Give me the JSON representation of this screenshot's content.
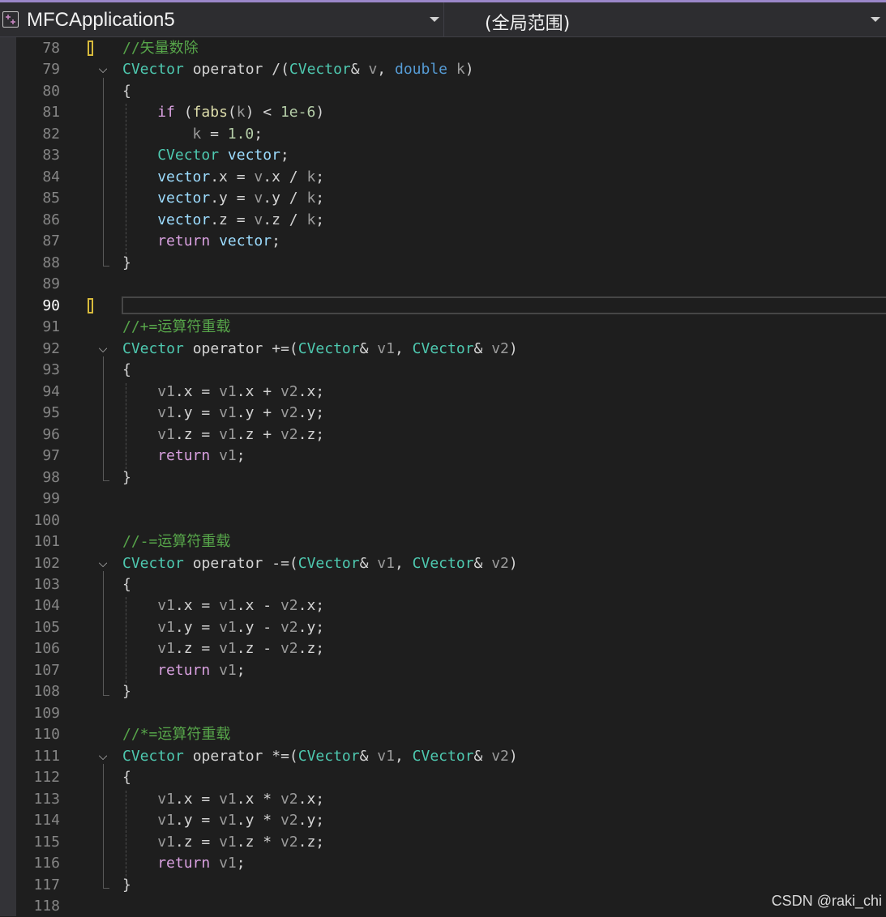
{
  "toolbar": {
    "project_name": "MFCApplication5",
    "project_icon": "cpp-project-icon",
    "scope": "(全局范围)"
  },
  "editor": {
    "active_line": "90",
    "lines": [
      {
        "n": "78",
        "mark": true,
        "tokens": [
          [
            "cmt",
            "//矢量数除"
          ]
        ]
      },
      {
        "n": "79",
        "fold": true,
        "tokens": [
          [
            "typ",
            "CVector"
          ],
          [
            "",
            " operator /("
          ],
          [
            "typ",
            "CVector"
          ],
          [
            "",
            "& "
          ],
          [
            "par",
            "v"
          ],
          [
            "",
            ", "
          ],
          [
            "kw",
            "double"
          ],
          [
            "",
            " "
          ],
          [
            "par",
            "k"
          ],
          [
            "",
            ")"
          ]
        ]
      },
      {
        "n": "80",
        "tokens": [
          [
            "",
            "{"
          ]
        ]
      },
      {
        "n": "81",
        "indent": 2,
        "tokens": [
          [
            "ctl",
            "if"
          ],
          [
            "",
            " ("
          ],
          [
            "fn",
            "fabs"
          ],
          [
            "",
            "("
          ],
          [
            "par",
            "k"
          ],
          [
            "",
            ") < "
          ],
          [
            "num",
            "1e-6"
          ],
          [
            "",
            ")"
          ]
        ]
      },
      {
        "n": "82",
        "indent": 4,
        "tokens": [
          [
            "par",
            "k"
          ],
          [
            "",
            " = "
          ],
          [
            "num",
            "1.0"
          ],
          [
            "",
            ";"
          ]
        ]
      },
      {
        "n": "83",
        "indent": 2,
        "tokens": [
          [
            "typ",
            "CVector"
          ],
          [
            "",
            " "
          ],
          [
            "var",
            "vector"
          ],
          [
            "",
            ";"
          ]
        ]
      },
      {
        "n": "84",
        "indent": 2,
        "tokens": [
          [
            "var",
            "vector"
          ],
          [
            "",
            ".x = "
          ],
          [
            "par",
            "v"
          ],
          [
            "",
            ".x / "
          ],
          [
            "par",
            "k"
          ],
          [
            "",
            ";"
          ]
        ]
      },
      {
        "n": "85",
        "indent": 2,
        "tokens": [
          [
            "var",
            "vector"
          ],
          [
            "",
            ".y = "
          ],
          [
            "par",
            "v"
          ],
          [
            "",
            ".y / "
          ],
          [
            "par",
            "k"
          ],
          [
            "",
            ";"
          ]
        ]
      },
      {
        "n": "86",
        "indent": 2,
        "tokens": [
          [
            "var",
            "vector"
          ],
          [
            "",
            ".z = "
          ],
          [
            "par",
            "v"
          ],
          [
            "",
            ".z / "
          ],
          [
            "par",
            "k"
          ],
          [
            "",
            ";"
          ]
        ]
      },
      {
        "n": "87",
        "indent": 2,
        "tokens": [
          [
            "ctl",
            "return"
          ],
          [
            "",
            " "
          ],
          [
            "var",
            "vector"
          ],
          [
            "",
            ";"
          ]
        ]
      },
      {
        "n": "88",
        "tokens": [
          [
            "",
            "}"
          ]
        ]
      },
      {
        "n": "89",
        "tokens": []
      },
      {
        "n": "90",
        "mark": true,
        "current": true,
        "tokens": []
      },
      {
        "n": "91",
        "tokens": [
          [
            "cmt",
            "//+=运算符重载"
          ]
        ]
      },
      {
        "n": "92",
        "fold": true,
        "tokens": [
          [
            "typ",
            "CVector"
          ],
          [
            "",
            " operator +=("
          ],
          [
            "typ",
            "CVector"
          ],
          [
            "",
            "& "
          ],
          [
            "par",
            "v1"
          ],
          [
            "",
            ", "
          ],
          [
            "typ",
            "CVector"
          ],
          [
            "",
            "& "
          ],
          [
            "par",
            "v2"
          ],
          [
            "",
            ")"
          ]
        ]
      },
      {
        "n": "93",
        "tokens": [
          [
            "",
            "{"
          ]
        ]
      },
      {
        "n": "94",
        "indent": 2,
        "tokens": [
          [
            "par",
            "v1"
          ],
          [
            "",
            ".x = "
          ],
          [
            "par",
            "v1"
          ],
          [
            "",
            ".x + "
          ],
          [
            "par",
            "v2"
          ],
          [
            "",
            ".x;"
          ]
        ]
      },
      {
        "n": "95",
        "indent": 2,
        "tokens": [
          [
            "par",
            "v1"
          ],
          [
            "",
            ".y = "
          ],
          [
            "par",
            "v1"
          ],
          [
            "",
            ".y + "
          ],
          [
            "par",
            "v2"
          ],
          [
            "",
            ".y;"
          ]
        ]
      },
      {
        "n": "96",
        "indent": 2,
        "tokens": [
          [
            "par",
            "v1"
          ],
          [
            "",
            ".z = "
          ],
          [
            "par",
            "v1"
          ],
          [
            "",
            ".z + "
          ],
          [
            "par",
            "v2"
          ],
          [
            "",
            ".z;"
          ]
        ]
      },
      {
        "n": "97",
        "indent": 2,
        "tokens": [
          [
            "ctl",
            "return"
          ],
          [
            "",
            " "
          ],
          [
            "par",
            "v1"
          ],
          [
            "",
            ";"
          ]
        ]
      },
      {
        "n": "98",
        "tokens": [
          [
            "",
            "}"
          ]
        ]
      },
      {
        "n": "99",
        "tokens": []
      },
      {
        "n": "100",
        "tokens": []
      },
      {
        "n": "101",
        "tokens": [
          [
            "cmt",
            "//-=运算符重载"
          ]
        ]
      },
      {
        "n": "102",
        "fold": true,
        "tokens": [
          [
            "typ",
            "CVector"
          ],
          [
            "",
            " operator -=("
          ],
          [
            "typ",
            "CVector"
          ],
          [
            "",
            "& "
          ],
          [
            "par",
            "v1"
          ],
          [
            "",
            ", "
          ],
          [
            "typ",
            "CVector"
          ],
          [
            "",
            "& "
          ],
          [
            "par",
            "v2"
          ],
          [
            "",
            ")"
          ]
        ]
      },
      {
        "n": "103",
        "tokens": [
          [
            "",
            "{"
          ]
        ]
      },
      {
        "n": "104",
        "indent": 2,
        "tokens": [
          [
            "par",
            "v1"
          ],
          [
            "",
            ".x = "
          ],
          [
            "par",
            "v1"
          ],
          [
            "",
            ".x - "
          ],
          [
            "par",
            "v2"
          ],
          [
            "",
            ".x;"
          ]
        ]
      },
      {
        "n": "105",
        "indent": 2,
        "tokens": [
          [
            "par",
            "v1"
          ],
          [
            "",
            ".y = "
          ],
          [
            "par",
            "v1"
          ],
          [
            "",
            ".y - "
          ],
          [
            "par",
            "v2"
          ],
          [
            "",
            ".y;"
          ]
        ]
      },
      {
        "n": "106",
        "indent": 2,
        "tokens": [
          [
            "par",
            "v1"
          ],
          [
            "",
            ".z = "
          ],
          [
            "par",
            "v1"
          ],
          [
            "",
            ".z - "
          ],
          [
            "par",
            "v2"
          ],
          [
            "",
            ".z;"
          ]
        ]
      },
      {
        "n": "107",
        "indent": 2,
        "tokens": [
          [
            "ctl",
            "return"
          ],
          [
            "",
            " "
          ],
          [
            "par",
            "v1"
          ],
          [
            "",
            ";"
          ]
        ]
      },
      {
        "n": "108",
        "tokens": [
          [
            "",
            "}"
          ]
        ]
      },
      {
        "n": "109",
        "tokens": []
      },
      {
        "n": "110",
        "tokens": [
          [
            "cmt",
            "//*=运算符重载"
          ]
        ]
      },
      {
        "n": "111",
        "fold": true,
        "tokens": [
          [
            "typ",
            "CVector"
          ],
          [
            "",
            " operator *=("
          ],
          [
            "typ",
            "CVector"
          ],
          [
            "",
            "& "
          ],
          [
            "par",
            "v1"
          ],
          [
            "",
            ", "
          ],
          [
            "typ",
            "CVector"
          ],
          [
            "",
            "& "
          ],
          [
            "par",
            "v2"
          ],
          [
            "",
            ")"
          ]
        ]
      },
      {
        "n": "112",
        "tokens": [
          [
            "",
            "{"
          ]
        ]
      },
      {
        "n": "113",
        "indent": 2,
        "tokens": [
          [
            "par",
            "v1"
          ],
          [
            "",
            ".x = "
          ],
          [
            "par",
            "v1"
          ],
          [
            "",
            ".x * "
          ],
          [
            "par",
            "v2"
          ],
          [
            "",
            ".x;"
          ]
        ]
      },
      {
        "n": "114",
        "indent": 2,
        "tokens": [
          [
            "par",
            "v1"
          ],
          [
            "",
            ".y = "
          ],
          [
            "par",
            "v1"
          ],
          [
            "",
            ".y * "
          ],
          [
            "par",
            "v2"
          ],
          [
            "",
            ".y;"
          ]
        ]
      },
      {
        "n": "115",
        "indent": 2,
        "tokens": [
          [
            "par",
            "v1"
          ],
          [
            "",
            ".z = "
          ],
          [
            "par",
            "v1"
          ],
          [
            "",
            ".z * "
          ],
          [
            "par",
            "v2"
          ],
          [
            "",
            ".z;"
          ]
        ]
      },
      {
        "n": "116",
        "indent": 2,
        "tokens": [
          [
            "ctl",
            "return"
          ],
          [
            "",
            " "
          ],
          [
            "par",
            "v1"
          ],
          [
            "",
            ";"
          ]
        ]
      },
      {
        "n": "117",
        "tokens": [
          [
            "",
            "}"
          ]
        ]
      },
      {
        "n": "118",
        "tokens": []
      }
    ]
  },
  "watermark": "CSDN @raki_chi"
}
